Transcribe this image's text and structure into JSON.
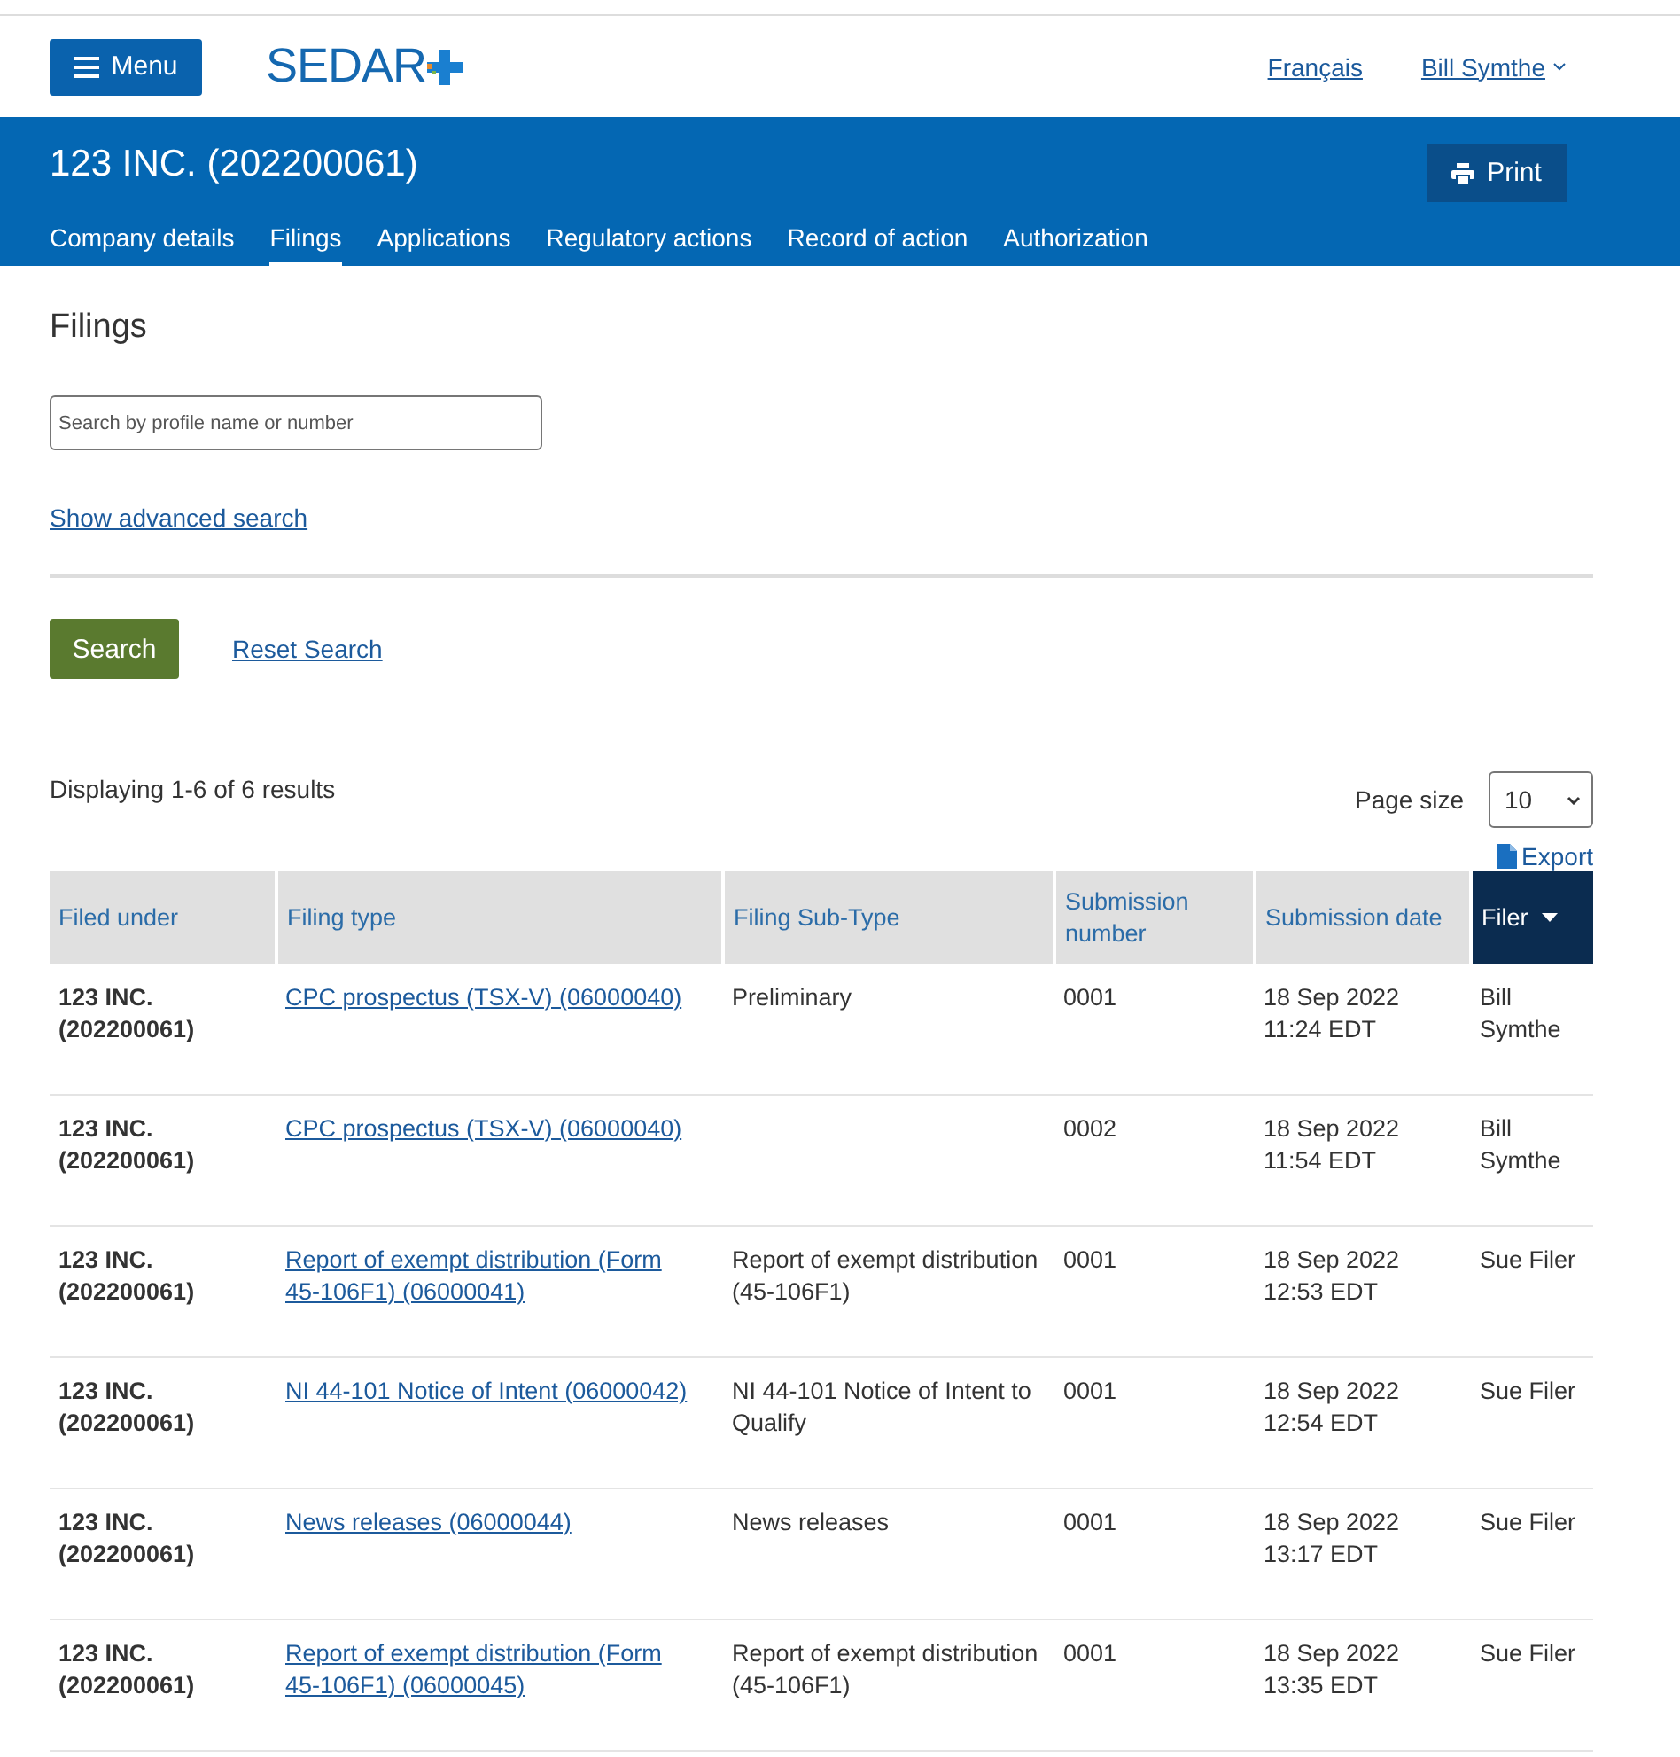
{
  "header": {
    "menu_button": "Menu",
    "logo": "SEDAR",
    "links": [
      {
        "label": "Français",
        "kind": "link"
      },
      {
        "label": "Bill Symthe",
        "kind": "dropdown"
      }
    ]
  },
  "banner": {
    "title": "123 INC. (202200061)",
    "print_button": "Print",
    "tabs": [
      {
        "label": "Company details",
        "selected": false
      },
      {
        "label": "Filings",
        "selected": true
      },
      {
        "label": "Applications",
        "selected": false
      },
      {
        "label": "Regulatory actions",
        "selected": false
      },
      {
        "label": "Record of action",
        "selected": false
      },
      {
        "label": "Authorization",
        "selected": false
      }
    ]
  },
  "page_title": "Filings",
  "search": {
    "placeholder": "Search by profile name or number",
    "advanced_link": "Show advanced search",
    "search_button": "Search",
    "reset_link": "Reset Search"
  },
  "results": {
    "summary": "Displaying 1-6 of 6 results",
    "page_size_label": "Page size",
    "page_size": "10",
    "export_link": "Export"
  },
  "table": {
    "columns": [
      {
        "label": "Filed under",
        "sorted": false
      },
      {
        "label": "Filing type",
        "sorted": false
      },
      {
        "label": "Filing Sub-Type",
        "sorted": false
      },
      {
        "label": "Submission number",
        "sorted": false
      },
      {
        "label": "Submission date",
        "sorted": false
      },
      {
        "label": "Filer",
        "sorted": true
      }
    ],
    "rows": [
      {
        "filed_under": "123 INC. (202200061)",
        "filing_type": "CPC prospectus (TSX-V) (06000040)",
        "sub_type": "Preliminary",
        "number": "0001",
        "date": "18 Sep 2022 11:24 EDT",
        "filer": "Bill Symthe"
      },
      {
        "filed_under": "123 INC. (202200061)",
        "filing_type": "CPC prospectus (TSX-V) (06000040)",
        "number": "0002",
        "date": "18 Sep 2022 11:54 EDT",
        "filer": "Bill Symthe"
      },
      {
        "filed_under": "123 INC. (202200061)",
        "filing_type": "Report of exempt distribution (Form 45-106F1) (06000041)",
        "sub_type": "Report of exempt distribution (45-106F1)",
        "number": "0001",
        "date": "18 Sep 2022 12:53 EDT",
        "filer": "Sue Filer"
      },
      {
        "filed_under": "123 INC. (202200061)",
        "filing_type": "NI 44-101 Notice of Intent (06000042)",
        "sub_type": "NI 44-101 Notice of Intent to Qualify",
        "number": "0001",
        "date": "18 Sep 2022 12:54 EDT",
        "filer": "Sue Filer"
      },
      {
        "filed_under": "123 INC. (202200061)",
        "filing_type": "News releases (06000044)",
        "sub_type": "News releases",
        "number": "0001",
        "date": "18 Sep 2022 13:17 EDT",
        "filer": "Sue Filer"
      },
      {
        "filed_under": "123 INC. (202200061)",
        "filing_type": "Report of exempt distribution (Form 45-106F1) (06000045)",
        "sub_type": "Report of exempt distribution (45-106F1)",
        "number": "0001",
        "date": "18 Sep 2022 13:35 EDT",
        "filer": "Sue Filer"
      }
    ]
  }
}
